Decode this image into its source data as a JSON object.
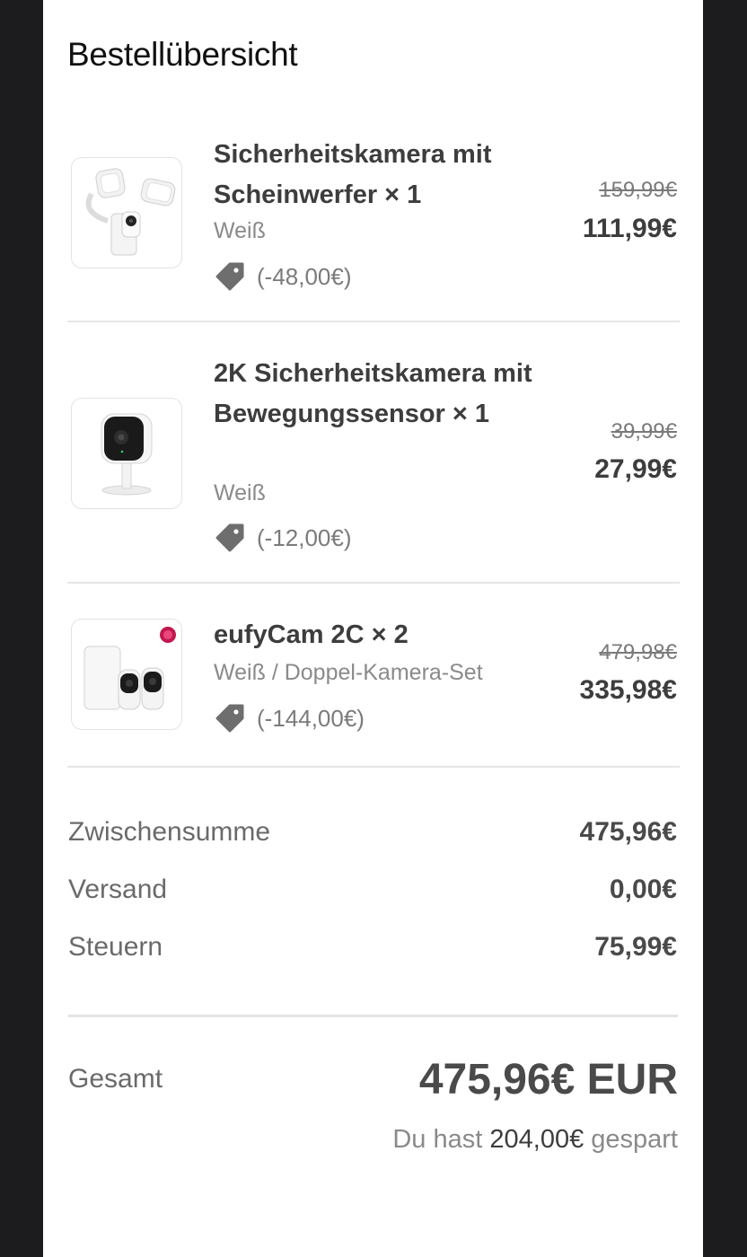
{
  "page_title": "Bestellübersicht",
  "items": [
    {
      "name": "Sicherheitskamera mit Scheinwerfer × 1",
      "variant": "Weiß",
      "discount": "(-48,00€)",
      "old_price": "159,99€",
      "price": "111,99€",
      "image_icon": "floodlight-camera-icon"
    },
    {
      "name": "2K Sicherheitskamera mit Bewegungssensor × 1",
      "variant": "Weiß",
      "discount": "(-12,00€)",
      "old_price": "39,99€",
      "price": "27,99€",
      "image_icon": "indoor-camera-icon"
    },
    {
      "name": "eufyCam 2C × 2",
      "variant": "Weiß / Doppel-Kamera-Set",
      "discount": "(-144,00€)",
      "old_price": "479,98€",
      "price": "335,98€",
      "image_icon": "camera-set-icon"
    }
  ],
  "summary": {
    "subtotal_label": "Zwischensumme",
    "subtotal_value": "475,96€",
    "shipping_label": "Versand",
    "shipping_value": "0,00€",
    "tax_label": "Steuern",
    "tax_value": "75,99€"
  },
  "total": {
    "label": "Gesamt",
    "value": "475,96€ EUR",
    "saved_prefix": "Du hast",
    "saved_amount": "204,00€",
    "saved_suffix": "gespart"
  },
  "colors": {
    "background_side": "#1c1c1e",
    "sheet": "#ffffff",
    "text_dark": "#3d3d3d",
    "text_muted": "#8a8a8a",
    "tag_icon": "#6e6e6e"
  }
}
